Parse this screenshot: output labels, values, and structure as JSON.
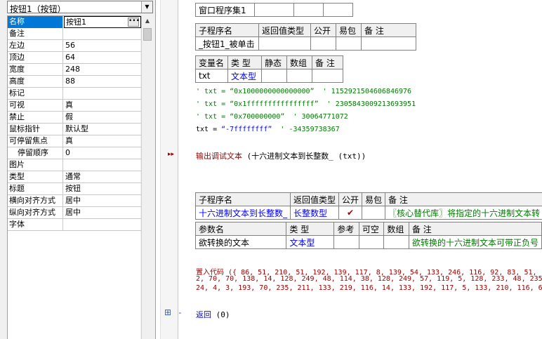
{
  "property_panel": {
    "object_selector": "按钮1（按钮）",
    "rows": [
      {
        "name": "名称",
        "value": "按钮1",
        "selected": true
      },
      {
        "name": "备注",
        "value": ""
      },
      {
        "name": "左边",
        "value": "56"
      },
      {
        "name": "顶边",
        "value": "64"
      },
      {
        "name": "宽度",
        "value": "248"
      },
      {
        "name": "高度",
        "value": "88"
      },
      {
        "name": "标记",
        "value": ""
      },
      {
        "name": "可视",
        "value": "真"
      },
      {
        "name": "禁止",
        "value": "假"
      },
      {
        "name": "鼠标指针",
        "value": "默认型"
      },
      {
        "name": "可停留焦点",
        "value": "真"
      },
      {
        "name": "停留顺序",
        "value": "0"
      },
      {
        "name": "图片",
        "value": ""
      },
      {
        "name": "类型",
        "value": "通常"
      },
      {
        "name": "标题",
        "value": "按钮"
      },
      {
        "name": "横向对齐方式",
        "value": "居中"
      },
      {
        "name": "纵向对齐方式",
        "value": "居中"
      },
      {
        "name": "字体",
        "value": ""
      }
    ]
  },
  "code": {
    "assembly_name": "窗口程序集1",
    "sub1": {
      "headers": [
        "子程序名",
        "返回值类型",
        "公开",
        "易包",
        "备 注"
      ],
      "name": "_按钮1_被单击"
    },
    "var_table": {
      "headers": [
        "变量名",
        "类 型",
        "静态",
        "数组",
        "备 注"
      ],
      "name": "txt",
      "type": "文本型"
    },
    "comments": [
      {
        "code": "' txt = “0x1000000000000000”",
        "note": "' 1152921504606846976"
      },
      {
        "code": "' txt = “0x1ffffffffffffffff”",
        "note": "' 2305843009213693951"
      },
      {
        "code": "' txt = “0x700000000”",
        "note": "' 30064771072"
      }
    ],
    "assign_line": {
      "lhs": "txt = ",
      "value": "“-7ffffffff”",
      "note": "' -34359738367"
    },
    "debug_line": {
      "call": "输出调试文本",
      "arg": " (十六进制文本到长整数_ (txt))"
    },
    "sub2": {
      "headers": [
        "子程序名",
        "返回值类型",
        "公开",
        "易包",
        "备 注"
      ],
      "name": "十六进制文本到长整数_",
      "return_type": "长整数型",
      "public_mark": "✔",
      "note": "〖核心替代库〗将指定的十六进制文本转"
    },
    "param_table": {
      "headers": [
        "参数名",
        "类 型",
        "参考",
        "可空",
        "数组",
        "备 注"
      ],
      "name": "欲转换的文本",
      "type": "文本型",
      "note": "欲转换的十六进制文本可带正负号"
    },
    "embed_code": [
      "置入代码 ({ 86, 51, 210, 51, 192, 139, 117, 8, 139, 54, 133, 246, 116, 92, 83, 51,",
      "2, 70, 70, 138, 14, 128, 249, 48, 114, 38, 128, 249, 57, 119, 5, 128, 233, 48, 235,",
      "24, 4, 3, 193, 70, 235, 211, 133, 219, 116, 14, 133, 192, 117, 5, 133, 210, 116, 6,"
    ],
    "return_line": {
      "kw": "返回",
      "val": " (0)"
    },
    "plus": "+"
  },
  "colors": {
    "selection": "#0078d7",
    "keyword": "#0000ff",
    "comment": "#007a00",
    "call": "#a00000"
  }
}
